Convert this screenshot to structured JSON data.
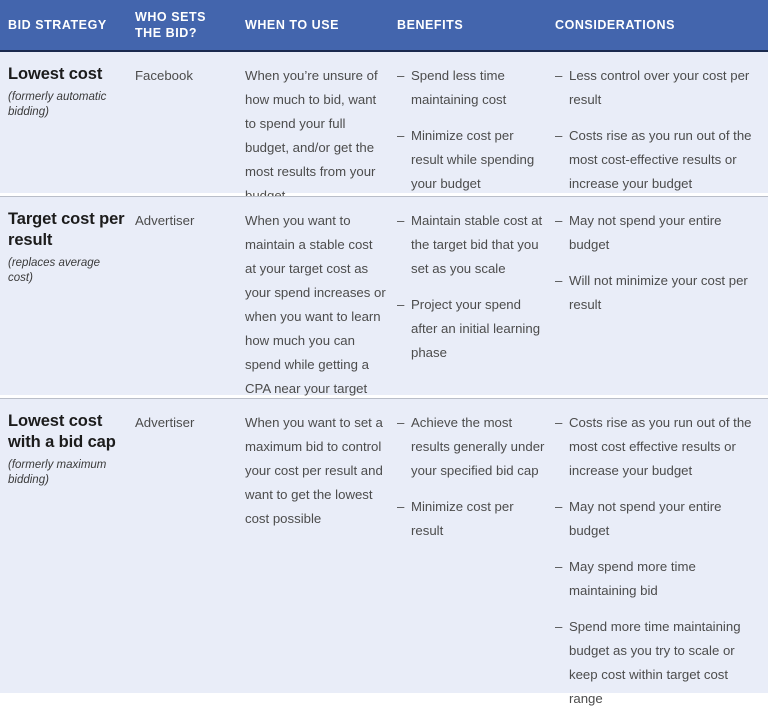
{
  "table": {
    "headers": [
      "BID STRATEGY",
      "WHO SETS\nTHE BID?",
      "WHEN TO USE",
      "BENEFITS",
      "CONSIDERATIONS"
    ],
    "header_labels": {
      "bid_strategy": "BID STRATEGY",
      "who_sets_the_bid_line1": "WHO SETS",
      "who_sets_the_bid_line2": "THE BID?",
      "when_to_use": "WHEN TO USE",
      "benefits": "BENEFITS",
      "considerations": "CONSIDERATIONS"
    },
    "rows": [
      {
        "strategy_name": "Lowest cost",
        "strategy_note": "(formerly automatic bidding)",
        "who_sets_bid": "Facebook",
        "when_to_use": "When you’re unsure of how much to bid, want to spend your full budget, and/or get the most results from your budget",
        "benefits": [
          "Spend less time maintaining cost",
          "Minimize cost per result while spending your budget"
        ],
        "considerations": [
          "Less control over your cost per result",
          "Costs rise as you run out of the most cost-effective results or increase your budget"
        ]
      },
      {
        "strategy_name": "Target cost per result",
        "strategy_note": "(replaces average cost)",
        "who_sets_bid": "Advertiser",
        "when_to_use": "When you want to maintain a stable cost at your target cost as your spend increases or when you want to learn how much you can spend while getting a CPA near your target cost",
        "benefits": [
          "Maintain stable cost at the target bid that you set as you scale",
          "Project your spend after an initial learning phase"
        ],
        "considerations": [
          "May not spend your entire budget",
          "Will not minimize your cost per result"
        ]
      },
      {
        "strategy_name": "Lowest cost with a bid cap",
        "strategy_note": "(formerly maximum bidding)",
        "who_sets_bid": "Advertiser",
        "when_to_use": "When you want to set a maximum bid to control your cost per result and want to get the lowest cost possible",
        "benefits": [
          "Achieve the most results generally under your specified bid cap",
          "Minimize cost per result"
        ],
        "considerations": [
          "Costs rise as you run out of the most cost effective results or increase your budget",
          "May not spend your entire budget",
          "May spend more time maintaining bid",
          "Spend more time maintaining budget as you try to scale or keep cost within target cost range"
        ]
      }
    ],
    "bullet_marker": "–",
    "colors": {
      "header_background": "#4365ad",
      "header_text": "#ffffff",
      "header_rule": "#1b2a4e",
      "row_background": "#e9edf8",
      "row_divider": "#ffffff",
      "body_text": "#4c4c4c",
      "strategy_text": "#1c1c1c"
    }
  }
}
